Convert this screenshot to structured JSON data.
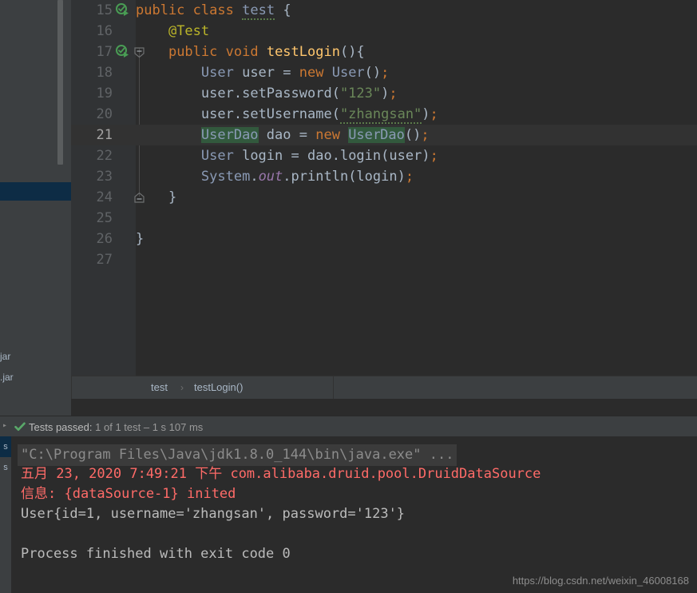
{
  "editor": {
    "first_line_number": 15,
    "current_line": 21,
    "lines": [
      {
        "number": 15,
        "tokens": [
          {
            "t": "public",
            "c": "kw"
          },
          {
            "t": " ",
            "c": "punct"
          },
          {
            "t": "class",
            "c": "kw"
          },
          {
            "t": " ",
            "c": "punct"
          },
          {
            "t": "test",
            "c": "cls squig"
          },
          {
            "t": " ",
            "c": "punct"
          },
          {
            "t": "{",
            "c": "punct"
          }
        ]
      },
      {
        "number": 16,
        "tokens": [
          {
            "t": "    ",
            "c": "punct"
          },
          {
            "t": "@Test",
            "c": "ann"
          }
        ]
      },
      {
        "number": 17,
        "tokens": [
          {
            "t": "    ",
            "c": "punct"
          },
          {
            "t": "public",
            "c": "kw"
          },
          {
            "t": " ",
            "c": "punct"
          },
          {
            "t": "void",
            "c": "kw"
          },
          {
            "t": " ",
            "c": "punct"
          },
          {
            "t": "testLogin",
            "c": "fn"
          },
          {
            "t": "(){",
            "c": "punct"
          }
        ]
      },
      {
        "number": 18,
        "tokens": [
          {
            "t": "        ",
            "c": "punct"
          },
          {
            "t": "User",
            "c": "cls"
          },
          {
            "t": " user ",
            "c": "type"
          },
          {
            "t": "= ",
            "c": "punct"
          },
          {
            "t": "new",
            "c": "kw"
          },
          {
            "t": " ",
            "c": "punct"
          },
          {
            "t": "User",
            "c": "cls"
          },
          {
            "t": "()",
            "c": "punct"
          },
          {
            "t": ";",
            "c": "semi"
          }
        ]
      },
      {
        "number": 19,
        "tokens": [
          {
            "t": "        ",
            "c": "punct"
          },
          {
            "t": "user",
            "c": "type"
          },
          {
            "t": ".",
            "c": "punct"
          },
          {
            "t": "setPassword",
            "c": "type"
          },
          {
            "t": "(",
            "c": "punct"
          },
          {
            "t": "\"123\"",
            "c": "str"
          },
          {
            "t": ")",
            "c": "punct"
          },
          {
            "t": ";",
            "c": "semi"
          }
        ]
      },
      {
        "number": 20,
        "tokens": [
          {
            "t": "        ",
            "c": "punct"
          },
          {
            "t": "user",
            "c": "type"
          },
          {
            "t": ".",
            "c": "punct"
          },
          {
            "t": "setUsername",
            "c": "type"
          },
          {
            "t": "(",
            "c": "punct"
          },
          {
            "t": "\"zhangsan\"",
            "c": "str squig"
          },
          {
            "t": ")",
            "c": "punct"
          },
          {
            "t": ";",
            "c": "semi"
          }
        ]
      },
      {
        "number": 21,
        "tokens": [
          {
            "t": "        ",
            "c": "punct"
          },
          {
            "t": "UserDao",
            "c": "cls hit"
          },
          {
            "t": " dao ",
            "c": "type"
          },
          {
            "t": "= ",
            "c": "punct"
          },
          {
            "t": "new",
            "c": "kw"
          },
          {
            "t": " ",
            "c": "punct"
          },
          {
            "t": "UserDao",
            "c": "cls hit caret-after"
          },
          {
            "t": "()",
            "c": "punct"
          },
          {
            "t": ";",
            "c": "semi"
          }
        ]
      },
      {
        "number": 22,
        "tokens": [
          {
            "t": "        ",
            "c": "punct"
          },
          {
            "t": "User",
            "c": "cls"
          },
          {
            "t": " login ",
            "c": "type"
          },
          {
            "t": "= ",
            "c": "punct"
          },
          {
            "t": "dao",
            "c": "type"
          },
          {
            "t": ".",
            "c": "punct"
          },
          {
            "t": "login",
            "c": "type"
          },
          {
            "t": "(user)",
            "c": "punct"
          },
          {
            "t": ";",
            "c": "semi"
          }
        ]
      },
      {
        "number": 23,
        "tokens": [
          {
            "t": "        ",
            "c": "punct"
          },
          {
            "t": "System",
            "c": "cls"
          },
          {
            "t": ".",
            "c": "punct"
          },
          {
            "t": "out",
            "c": "stat"
          },
          {
            "t": ".",
            "c": "punct"
          },
          {
            "t": "println",
            "c": "type"
          },
          {
            "t": "(login)",
            "c": "punct"
          },
          {
            "t": ";",
            "c": "semi"
          }
        ]
      },
      {
        "number": 24,
        "tokens": [
          {
            "t": "    ",
            "c": "punct"
          },
          {
            "t": "}",
            "c": "punct"
          }
        ]
      },
      {
        "number": 25,
        "tokens": []
      },
      {
        "number": 26,
        "tokens": [
          {
            "t": "}",
            "c": "punct"
          }
        ]
      },
      {
        "number": 27,
        "tokens": []
      }
    ],
    "gutter_run_icons": [
      {
        "line": 15,
        "name": "run-test-success-icon"
      },
      {
        "line": 17,
        "name": "run-test-success-icon"
      }
    ]
  },
  "breadcrumb": {
    "items": [
      "test",
      "testLogin()"
    ],
    "separator": "›"
  },
  "project_panel": {
    "file_a": "jar",
    "file_b": ".jar"
  },
  "test_toolwindow": {
    "vertical_tabs": [
      {
        "label": "s",
        "active": true
      },
      {
        "label": "s",
        "active": false
      }
    ],
    "status": {
      "icon": "green-check-icon",
      "prefix": "Tests passed:",
      "count": "1",
      "of": "of 1 test",
      "dash": "–",
      "duration": "1 s 107 ms"
    },
    "console_lines": [
      {
        "text": "\"C:\\Program Files\\Java\\jdk1.8.0_144\\bin\\java.exe\" ...",
        "style": "cmd"
      },
      {
        "text": "五月 23, 2020 7:49:21 下午 com.alibaba.druid.pool.DruidDataSource",
        "style": "err"
      },
      {
        "text": "信息: {dataSource-1} inited",
        "style": "err"
      },
      {
        "text": "User{id=1, username='zhangsan', password='123'}",
        "style": "out"
      },
      {
        "text": "",
        "style": "out"
      },
      {
        "text": "Process finished with exit code 0",
        "style": "out"
      }
    ]
  },
  "watermark": "https://blog.csdn.net/weixin_46008168",
  "colors": {
    "editor_bg": "#2b2b2b",
    "gutter_bg": "#313335",
    "panel_bg": "#3c3f41",
    "accent_selection": "#0d2c45",
    "keyword": "#cc7832",
    "string": "#6a8759",
    "annotation": "#bbb529",
    "method": "#ffc66d",
    "static_field": "#9876aa",
    "error_text": "#ff6b68",
    "success_green": "#59a869",
    "search_hit": "#32593d"
  }
}
